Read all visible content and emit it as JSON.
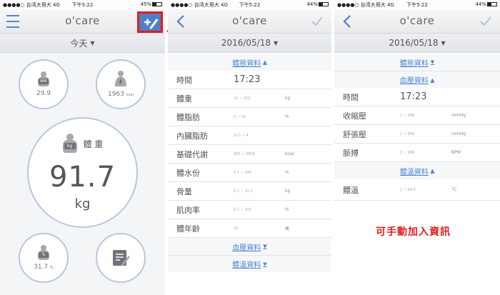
{
  "status_left": {
    "carrier": "●●●●○ 台湾大哥大 4G",
    "time": "下午5:22",
    "battery": "45%"
  },
  "status_mid": {
    "carrier": "●●●●○ 台湾大哥大 4G",
    "time": "下午5:22",
    "battery": "44%"
  },
  "status_right": {
    "carrier": "●●●●○ 台湾大哥大 4G",
    "time": "下午5:22",
    "battery": "44%"
  },
  "app_logo": "o'care",
  "home": {
    "date_label": "今天",
    "bmi": {
      "badge": "BMI",
      "value": "29.9"
    },
    "bmr": {
      "value": "1963",
      "unit": "kcal"
    },
    "weight": {
      "badge": "kg",
      "title": "體 重",
      "value": "91.7",
      "unit": "kg"
    },
    "bodyfat": {
      "badge": "%",
      "value": "31.7",
      "unit": "%"
    }
  },
  "entry_body": {
    "date": "2016/05/18",
    "section_body": "體態資料",
    "rows": [
      {
        "label": "時間",
        "big": "17:23",
        "range": "",
        "unit": ""
      },
      {
        "label": "體重",
        "big": "",
        "range": "10 ~ 150",
        "unit": "kg"
      },
      {
        "label": "體脂肪",
        "big": "",
        "range": "5 ~ 50",
        "unit": "%"
      },
      {
        "label": "內臟脂肪",
        "big": "",
        "range": "LV      1 ~ 4",
        "unit": ""
      },
      {
        "label": "基礎代謝",
        "big": "",
        "range": "385 ~ 3999",
        "unit": "kcal"
      },
      {
        "label": "體水份",
        "big": "",
        "range": "0.1 ~ 100",
        "unit": "%"
      },
      {
        "label": "骨量",
        "big": "",
        "range": "0.1 ~ 12.5",
        "unit": "kg"
      },
      {
        "label": "肌肉率",
        "big": "",
        "range": "0.1 ~ 100",
        "unit": "%"
      },
      {
        "label": "體年齡",
        "big": "",
        "range": "35",
        "unit": "歲"
      }
    ],
    "section_bp": "血壓資料",
    "section_temp": "體溫資料"
  },
  "entry_bp": {
    "date": "2016/05/18",
    "section_body": "體態資料",
    "section_bp": "血壓資料",
    "rows": [
      {
        "label": "時間",
        "big": "17:23",
        "range": "",
        "unit": ""
      },
      {
        "label": "收縮壓",
        "big": "",
        "range": "1 ~ 999",
        "unit": "mmHg"
      },
      {
        "label": "舒張壓",
        "big": "",
        "range": "1 ~ 999",
        "unit": "mmHg"
      },
      {
        "label": "脈搏",
        "big": "",
        "range": "1 ~ 999",
        "unit": "BPM"
      }
    ],
    "section_temp": "體溫資料",
    "temp_row": {
      "label": "體溫",
      "range": "1 ~ 99.9",
      "unit": "°C"
    },
    "note": "可手動加入資訊"
  },
  "colors": {
    "accent": "#4e7fc8",
    "highlight": "#e41b1b",
    "circle_border": "#b7c7de"
  }
}
